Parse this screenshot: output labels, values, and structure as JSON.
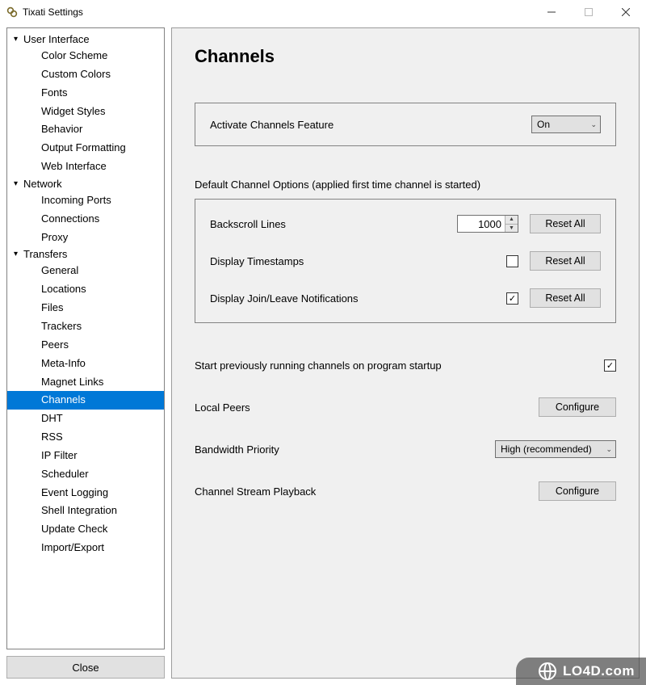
{
  "window": {
    "title": "Tixati Settings",
    "buttons": {
      "minimize": "–",
      "maximize": "▢",
      "close": "✕"
    }
  },
  "sidebar": {
    "groups": [
      {
        "label": "User Interface",
        "items": [
          "Color Scheme",
          "Custom Colors",
          "Fonts",
          "Widget Styles",
          "Behavior",
          "Output Formatting",
          "Web Interface"
        ]
      },
      {
        "label": "Network",
        "items": [
          "Incoming Ports",
          "Connections",
          "Proxy"
        ]
      },
      {
        "label": "Transfers",
        "items": [
          "General",
          "Locations",
          "Files",
          "Trackers",
          "Peers",
          "Meta-Info",
          "Magnet Links",
          "Channels",
          "DHT",
          "RSS",
          "IP Filter",
          "Scheduler",
          "Event Logging",
          "Shell Integration",
          "Update Check",
          "Import/Export"
        ]
      }
    ],
    "selected": "Channels",
    "close_label": "Close"
  },
  "page": {
    "title": "Channels",
    "activate": {
      "label": "Activate Channels Feature",
      "value": "On"
    },
    "default_options": {
      "heading": "Default Channel Options (applied first time channel is started)",
      "rows": [
        {
          "label": "Backscroll Lines",
          "type": "spin",
          "value": "1000",
          "button": "Reset All"
        },
        {
          "label": "Display Timestamps",
          "type": "check",
          "checked": false,
          "button": "Reset All"
        },
        {
          "label": "Display Join/Leave Notifications",
          "type": "check",
          "checked": true,
          "button": "Reset All"
        }
      ]
    },
    "startup": {
      "label": "Start previously running channels on program startup",
      "checked": true
    },
    "local_peers": {
      "label": "Local Peers",
      "button": "Configure"
    },
    "bandwidth": {
      "label": "Bandwidth Priority",
      "value": "High (recommended)"
    },
    "playback": {
      "label": "Channel Stream Playback",
      "button": "Configure"
    }
  },
  "watermark": "LO4D.com"
}
